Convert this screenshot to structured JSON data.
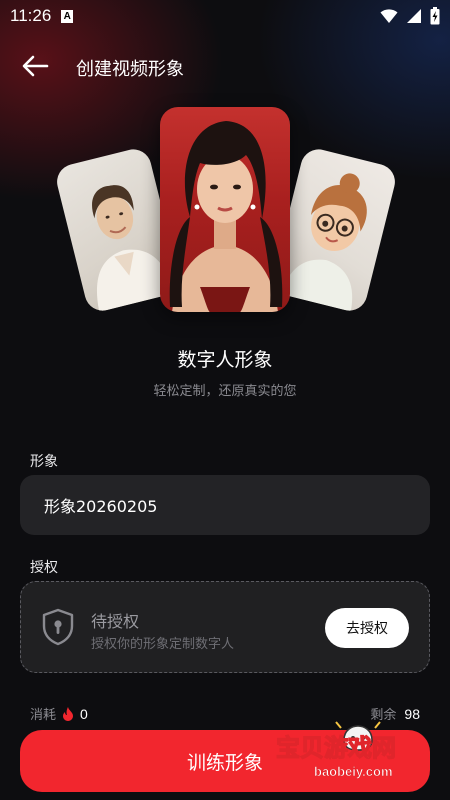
{
  "status_bar": {
    "time": "11:26",
    "notification_badge": "A",
    "icons": [
      "wifi-icon",
      "signal-icon",
      "battery-icon"
    ]
  },
  "header": {
    "back_icon": "arrow-left-icon",
    "title": "创建视频形象"
  },
  "hero": {
    "title": "数字人形象",
    "subtitle": "轻松定制，还原真实的您",
    "cards": [
      "older-woman-portrait",
      "young-woman-portrait",
      "cartoon-girl-portrait"
    ]
  },
  "form": {
    "image_label": "形象",
    "image_name_value": "形象20260205",
    "auth_label": "授权",
    "auth": {
      "icon": "shield-lock-icon",
      "status": "待授权",
      "description": "授权你的形象定制数字人",
      "button_label": "去授权"
    }
  },
  "footer": {
    "cost_label": "消耗",
    "cost_icon": "flame-icon",
    "cost_value": "0",
    "remain_label": "剩余",
    "remain_value": "98",
    "train_button_label": "训练形象"
  },
  "watermark": {
    "title": "宝贝游戏网",
    "url": "baobeiy.com"
  },
  "colors": {
    "accent": "#f2262e",
    "background": "#0d0d10",
    "field": "#232326"
  }
}
